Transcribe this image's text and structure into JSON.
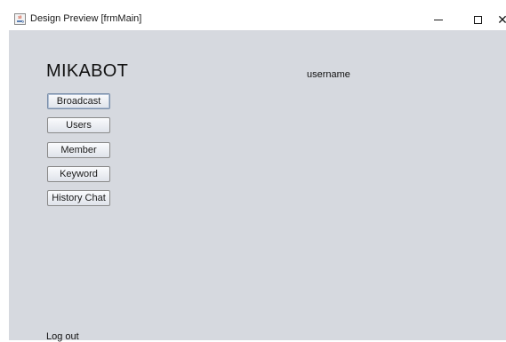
{
  "window": {
    "title": "Design Preview [frmMain]",
    "controls": {
      "minimize": "—",
      "maximize": "☐",
      "close": "✕"
    }
  },
  "main": {
    "brand": "MIKABOT",
    "username": "username",
    "nav": [
      {
        "label": "Broadcast"
      },
      {
        "label": "Users"
      },
      {
        "label": "Member"
      },
      {
        "label": "Keyword"
      },
      {
        "label": "History Chat"
      }
    ],
    "logout": "Log out"
  },
  "colors": {
    "background": "#d6d9df",
    "titlebar": "#ffffff"
  },
  "icons": {
    "app": "java-coffee-cup-icon"
  }
}
